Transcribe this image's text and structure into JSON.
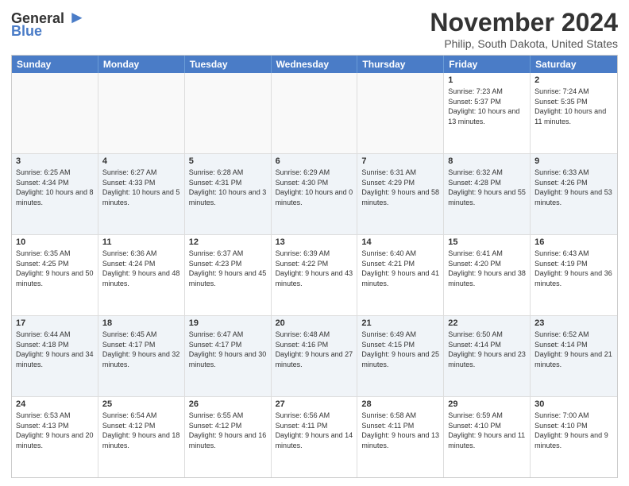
{
  "header": {
    "logo_line1": "General",
    "logo_line2": "Blue",
    "month_title": "November 2024",
    "location": "Philip, South Dakota, United States"
  },
  "days_of_week": [
    "Sunday",
    "Monday",
    "Tuesday",
    "Wednesday",
    "Thursday",
    "Friday",
    "Saturday"
  ],
  "weeks": [
    [
      {
        "day": "",
        "info": "",
        "empty": true
      },
      {
        "day": "",
        "info": "",
        "empty": true
      },
      {
        "day": "",
        "info": "",
        "empty": true
      },
      {
        "day": "",
        "info": "",
        "empty": true
      },
      {
        "day": "",
        "info": "",
        "empty": true
      },
      {
        "day": "1",
        "info": "Sunrise: 7:23 AM\nSunset: 5:37 PM\nDaylight: 10 hours and 13 minutes."
      },
      {
        "day": "2",
        "info": "Sunrise: 7:24 AM\nSunset: 5:35 PM\nDaylight: 10 hours and 11 minutes."
      }
    ],
    [
      {
        "day": "3",
        "info": "Sunrise: 6:25 AM\nSunset: 4:34 PM\nDaylight: 10 hours and 8 minutes."
      },
      {
        "day": "4",
        "info": "Sunrise: 6:27 AM\nSunset: 4:33 PM\nDaylight: 10 hours and 5 minutes."
      },
      {
        "day": "5",
        "info": "Sunrise: 6:28 AM\nSunset: 4:31 PM\nDaylight: 10 hours and 3 minutes."
      },
      {
        "day": "6",
        "info": "Sunrise: 6:29 AM\nSunset: 4:30 PM\nDaylight: 10 hours and 0 minutes."
      },
      {
        "day": "7",
        "info": "Sunrise: 6:31 AM\nSunset: 4:29 PM\nDaylight: 9 hours and 58 minutes."
      },
      {
        "day": "8",
        "info": "Sunrise: 6:32 AM\nSunset: 4:28 PM\nDaylight: 9 hours and 55 minutes."
      },
      {
        "day": "9",
        "info": "Sunrise: 6:33 AM\nSunset: 4:26 PM\nDaylight: 9 hours and 53 minutes."
      }
    ],
    [
      {
        "day": "10",
        "info": "Sunrise: 6:35 AM\nSunset: 4:25 PM\nDaylight: 9 hours and 50 minutes."
      },
      {
        "day": "11",
        "info": "Sunrise: 6:36 AM\nSunset: 4:24 PM\nDaylight: 9 hours and 48 minutes."
      },
      {
        "day": "12",
        "info": "Sunrise: 6:37 AM\nSunset: 4:23 PM\nDaylight: 9 hours and 45 minutes."
      },
      {
        "day": "13",
        "info": "Sunrise: 6:39 AM\nSunset: 4:22 PM\nDaylight: 9 hours and 43 minutes."
      },
      {
        "day": "14",
        "info": "Sunrise: 6:40 AM\nSunset: 4:21 PM\nDaylight: 9 hours and 41 minutes."
      },
      {
        "day": "15",
        "info": "Sunrise: 6:41 AM\nSunset: 4:20 PM\nDaylight: 9 hours and 38 minutes."
      },
      {
        "day": "16",
        "info": "Sunrise: 6:43 AM\nSunset: 4:19 PM\nDaylight: 9 hours and 36 minutes."
      }
    ],
    [
      {
        "day": "17",
        "info": "Sunrise: 6:44 AM\nSunset: 4:18 PM\nDaylight: 9 hours and 34 minutes."
      },
      {
        "day": "18",
        "info": "Sunrise: 6:45 AM\nSunset: 4:17 PM\nDaylight: 9 hours and 32 minutes."
      },
      {
        "day": "19",
        "info": "Sunrise: 6:47 AM\nSunset: 4:17 PM\nDaylight: 9 hours and 30 minutes."
      },
      {
        "day": "20",
        "info": "Sunrise: 6:48 AM\nSunset: 4:16 PM\nDaylight: 9 hours and 27 minutes."
      },
      {
        "day": "21",
        "info": "Sunrise: 6:49 AM\nSunset: 4:15 PM\nDaylight: 9 hours and 25 minutes."
      },
      {
        "day": "22",
        "info": "Sunrise: 6:50 AM\nSunset: 4:14 PM\nDaylight: 9 hours and 23 minutes."
      },
      {
        "day": "23",
        "info": "Sunrise: 6:52 AM\nSunset: 4:14 PM\nDaylight: 9 hours and 21 minutes."
      }
    ],
    [
      {
        "day": "24",
        "info": "Sunrise: 6:53 AM\nSunset: 4:13 PM\nDaylight: 9 hours and 20 minutes."
      },
      {
        "day": "25",
        "info": "Sunrise: 6:54 AM\nSunset: 4:12 PM\nDaylight: 9 hours and 18 minutes."
      },
      {
        "day": "26",
        "info": "Sunrise: 6:55 AM\nSunset: 4:12 PM\nDaylight: 9 hours and 16 minutes."
      },
      {
        "day": "27",
        "info": "Sunrise: 6:56 AM\nSunset: 4:11 PM\nDaylight: 9 hours and 14 minutes."
      },
      {
        "day": "28",
        "info": "Sunrise: 6:58 AM\nSunset: 4:11 PM\nDaylight: 9 hours and 13 minutes."
      },
      {
        "day": "29",
        "info": "Sunrise: 6:59 AM\nSunset: 4:10 PM\nDaylight: 9 hours and 11 minutes."
      },
      {
        "day": "30",
        "info": "Sunrise: 7:00 AM\nSunset: 4:10 PM\nDaylight: 9 hours and 9 minutes."
      }
    ]
  ]
}
